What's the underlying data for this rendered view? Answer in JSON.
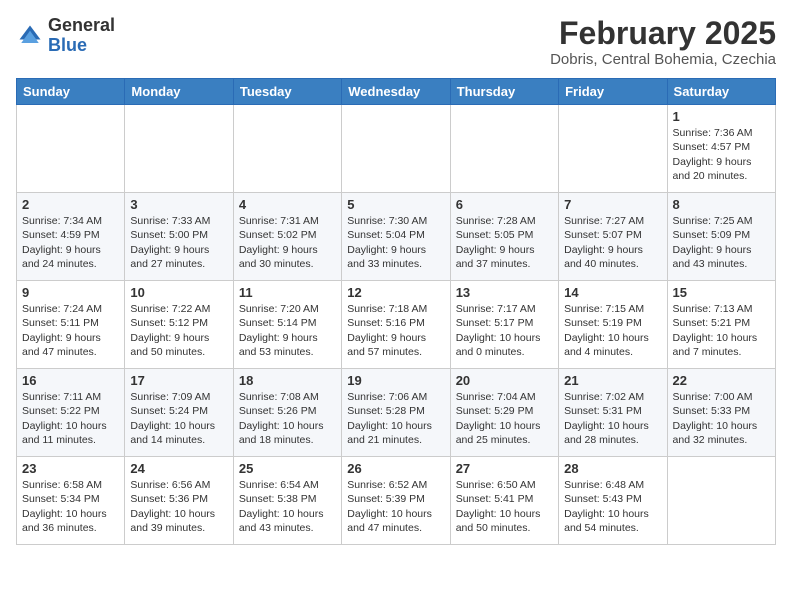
{
  "logo": {
    "general": "General",
    "blue": "Blue"
  },
  "header": {
    "month_year": "February 2025",
    "location": "Dobris, Central Bohemia, Czechia"
  },
  "weekdays": [
    "Sunday",
    "Monday",
    "Tuesday",
    "Wednesday",
    "Thursday",
    "Friday",
    "Saturday"
  ],
  "weeks": [
    [
      {
        "day": "",
        "info": ""
      },
      {
        "day": "",
        "info": ""
      },
      {
        "day": "",
        "info": ""
      },
      {
        "day": "",
        "info": ""
      },
      {
        "day": "",
        "info": ""
      },
      {
        "day": "",
        "info": ""
      },
      {
        "day": "1",
        "info": "Sunrise: 7:36 AM\nSunset: 4:57 PM\nDaylight: 9 hours\nand 20 minutes."
      }
    ],
    [
      {
        "day": "2",
        "info": "Sunrise: 7:34 AM\nSunset: 4:59 PM\nDaylight: 9 hours\nand 24 minutes."
      },
      {
        "day": "3",
        "info": "Sunrise: 7:33 AM\nSunset: 5:00 PM\nDaylight: 9 hours\nand 27 minutes."
      },
      {
        "day": "4",
        "info": "Sunrise: 7:31 AM\nSunset: 5:02 PM\nDaylight: 9 hours\nand 30 minutes."
      },
      {
        "day": "5",
        "info": "Sunrise: 7:30 AM\nSunset: 5:04 PM\nDaylight: 9 hours\nand 33 minutes."
      },
      {
        "day": "6",
        "info": "Sunrise: 7:28 AM\nSunset: 5:05 PM\nDaylight: 9 hours\nand 37 minutes."
      },
      {
        "day": "7",
        "info": "Sunrise: 7:27 AM\nSunset: 5:07 PM\nDaylight: 9 hours\nand 40 minutes."
      },
      {
        "day": "8",
        "info": "Sunrise: 7:25 AM\nSunset: 5:09 PM\nDaylight: 9 hours\nand 43 minutes."
      }
    ],
    [
      {
        "day": "9",
        "info": "Sunrise: 7:24 AM\nSunset: 5:11 PM\nDaylight: 9 hours\nand 47 minutes."
      },
      {
        "day": "10",
        "info": "Sunrise: 7:22 AM\nSunset: 5:12 PM\nDaylight: 9 hours\nand 50 minutes."
      },
      {
        "day": "11",
        "info": "Sunrise: 7:20 AM\nSunset: 5:14 PM\nDaylight: 9 hours\nand 53 minutes."
      },
      {
        "day": "12",
        "info": "Sunrise: 7:18 AM\nSunset: 5:16 PM\nDaylight: 9 hours\nand 57 minutes."
      },
      {
        "day": "13",
        "info": "Sunrise: 7:17 AM\nSunset: 5:17 PM\nDaylight: 10 hours\nand 0 minutes."
      },
      {
        "day": "14",
        "info": "Sunrise: 7:15 AM\nSunset: 5:19 PM\nDaylight: 10 hours\nand 4 minutes."
      },
      {
        "day": "15",
        "info": "Sunrise: 7:13 AM\nSunset: 5:21 PM\nDaylight: 10 hours\nand 7 minutes."
      }
    ],
    [
      {
        "day": "16",
        "info": "Sunrise: 7:11 AM\nSunset: 5:22 PM\nDaylight: 10 hours\nand 11 minutes."
      },
      {
        "day": "17",
        "info": "Sunrise: 7:09 AM\nSunset: 5:24 PM\nDaylight: 10 hours\nand 14 minutes."
      },
      {
        "day": "18",
        "info": "Sunrise: 7:08 AM\nSunset: 5:26 PM\nDaylight: 10 hours\nand 18 minutes."
      },
      {
        "day": "19",
        "info": "Sunrise: 7:06 AM\nSunset: 5:28 PM\nDaylight: 10 hours\nand 21 minutes."
      },
      {
        "day": "20",
        "info": "Sunrise: 7:04 AM\nSunset: 5:29 PM\nDaylight: 10 hours\nand 25 minutes."
      },
      {
        "day": "21",
        "info": "Sunrise: 7:02 AM\nSunset: 5:31 PM\nDaylight: 10 hours\nand 28 minutes."
      },
      {
        "day": "22",
        "info": "Sunrise: 7:00 AM\nSunset: 5:33 PM\nDaylight: 10 hours\nand 32 minutes."
      }
    ],
    [
      {
        "day": "23",
        "info": "Sunrise: 6:58 AM\nSunset: 5:34 PM\nDaylight: 10 hours\nand 36 minutes."
      },
      {
        "day": "24",
        "info": "Sunrise: 6:56 AM\nSunset: 5:36 PM\nDaylight: 10 hours\nand 39 minutes."
      },
      {
        "day": "25",
        "info": "Sunrise: 6:54 AM\nSunset: 5:38 PM\nDaylight: 10 hours\nand 43 minutes."
      },
      {
        "day": "26",
        "info": "Sunrise: 6:52 AM\nSunset: 5:39 PM\nDaylight: 10 hours\nand 47 minutes."
      },
      {
        "day": "27",
        "info": "Sunrise: 6:50 AM\nSunset: 5:41 PM\nDaylight: 10 hours\nand 50 minutes."
      },
      {
        "day": "28",
        "info": "Sunrise: 6:48 AM\nSunset: 5:43 PM\nDaylight: 10 hours\nand 54 minutes."
      },
      {
        "day": "",
        "info": ""
      }
    ]
  ]
}
